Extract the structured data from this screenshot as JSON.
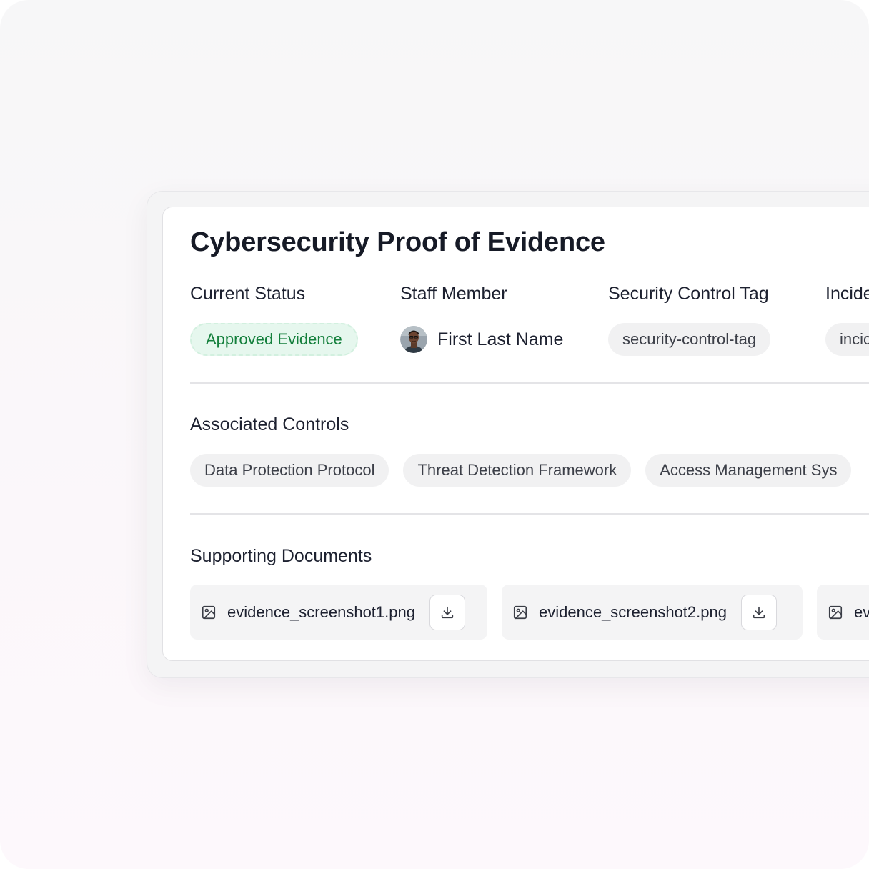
{
  "card": {
    "title": "Cybersecurity Proof of Evidence"
  },
  "meta": {
    "status": {
      "label": "Current Status",
      "value": "Approved Evidence",
      "color": "#15803d",
      "bg": "#e6f7ee"
    },
    "staff": {
      "label": "Staff Member",
      "name": "First Last Name"
    },
    "tag": {
      "label": "Security Control Tag",
      "value": "security-control-tag"
    },
    "incident": {
      "label": "Incide",
      "value": "incic"
    }
  },
  "associated": {
    "label": "Associated Controls",
    "controls": [
      "Data Protection Protocol",
      "Threat Detection Framework",
      "Access Management Sys"
    ]
  },
  "documents": {
    "label": "Supporting Documents",
    "files": [
      {
        "name": "evidence_screenshot1.png",
        "icon": "image-file-icon",
        "action_icon": "download-icon"
      },
      {
        "name": "evidence_screenshot2.png",
        "icon": "image-file-icon",
        "action_icon": "download-icon"
      },
      {
        "name": "ev",
        "icon": "image-file-icon"
      }
    ]
  }
}
